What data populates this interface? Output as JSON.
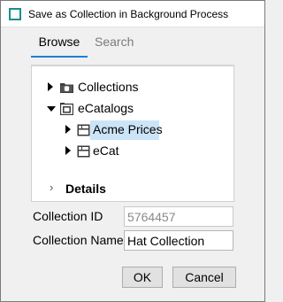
{
  "window": {
    "title": "Save as Collection in Background Process"
  },
  "tabs": [
    {
      "label": "Browse",
      "active": true
    },
    {
      "label": "Search",
      "active": false
    }
  ],
  "tree": {
    "nodes": [
      {
        "label": "Collections",
        "expanded": false,
        "icon": "folder-db-icon"
      },
      {
        "label": "eCatalogs",
        "expanded": true,
        "icon": "catalog-folder-icon"
      },
      {
        "label": "Acme Prices",
        "expanded": false,
        "selected": true,
        "icon": "catalog-icon"
      },
      {
        "label": "eCat",
        "expanded": false,
        "icon": "catalog-icon"
      }
    ],
    "selection_color": "#cce4f7"
  },
  "details": {
    "label": "Details"
  },
  "form": {
    "collection_id_label": "Collection ID",
    "collection_id_value": "5764457",
    "collection_name_label": "Collection Name",
    "collection_name_value": "Hat Collection"
  },
  "buttons": {
    "ok": "OK",
    "cancel": "Cancel"
  },
  "colors": {
    "accent": "#1e7fd6",
    "app_icon": "#1a8f8f"
  }
}
